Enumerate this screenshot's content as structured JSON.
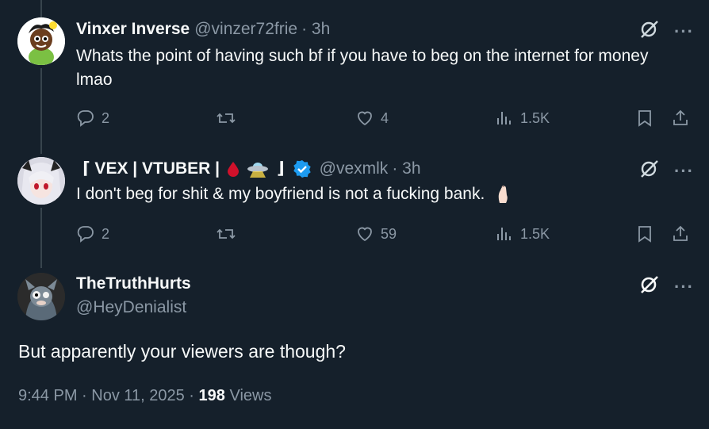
{
  "tweets": [
    {
      "display_name": "Vinxer Inverse",
      "handle": "@vinzer72frie",
      "time": "· 3h",
      "text": "Whats the point of having such bf if you have to beg on the internet for money lmao",
      "replies": "2",
      "retweets": "",
      "likes": "4",
      "views": "1.5K"
    },
    {
      "display_name_prefix": "⌈ VEX | VTUBER |",
      "display_name_suffix": "⌋",
      "name_emojis": [
        "drop-of-blood",
        "flying-saucer"
      ],
      "handle": "@vexmlk",
      "time": "· 3h",
      "text": "I don't beg for shit & my boyfriend is not a fucking bank.",
      "text_emoji": "pinched-fingers",
      "verified": true,
      "replies": "2",
      "retweets": "",
      "likes": "59",
      "views": "1.5K"
    }
  ],
  "main_tweet": {
    "display_name": "TheTruthHurts",
    "handle": "@HeyDenialist",
    "text": "But apparently your viewers are though?",
    "timestamp": "9:44 PM · Nov 11, 2025 ·",
    "views_count": "198",
    "views_label": "Views"
  },
  "colors": {
    "background": "#15202b",
    "text_primary": "#f7f9f9",
    "text_secondary": "#8b98a5",
    "verified": "#1d9bf0",
    "thread_line": "#38444d"
  },
  "icons": [
    "reply-icon",
    "retweet-icon",
    "like-icon",
    "views-icon",
    "bookmark-icon",
    "share-icon",
    "grok-icon",
    "more-icon",
    "verified-badge-icon"
  ]
}
